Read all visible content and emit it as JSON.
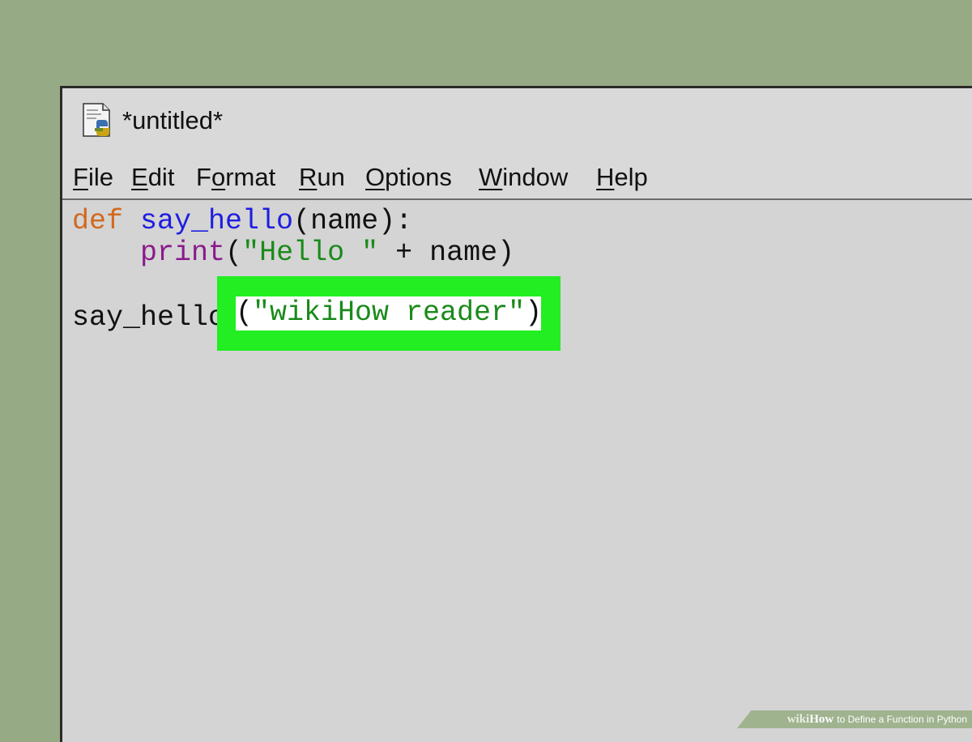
{
  "window": {
    "title": "*untitled*",
    "icon": "python-file-icon"
  },
  "menu": {
    "items": [
      {
        "first": "F",
        "rest": "ile"
      },
      {
        "first": "E",
        "rest": "dit"
      },
      {
        "pre": "F",
        "first": "o",
        "rest": "rmat"
      },
      {
        "first": "R",
        "rest": "un"
      },
      {
        "first": "O",
        "rest": "ptions"
      },
      {
        "first": "W",
        "rest": "indow"
      },
      {
        "first": "H",
        "rest": "elp"
      }
    ]
  },
  "code": {
    "line1": {
      "kw": "def",
      "space": " ",
      "name": "say_hello",
      "rest": "(name):"
    },
    "line2": {
      "indent": "    ",
      "builtin": "print",
      "open": "(",
      "string": "\"Hello \"",
      "rest": " + name)"
    },
    "line4": {
      "call": "say_hello",
      "open": "(",
      "string": "\"wikiHow reader\"",
      "close": ")"
    }
  },
  "watermark": {
    "wiki": "wiki",
    "how": "How",
    "text": "to Define a Function in Python"
  },
  "colors": {
    "background": "#96aa86",
    "keyword": "#d2691e",
    "function": "#1e1ee0",
    "builtin": "#8b1a8b",
    "string": "#1a8a1a",
    "highlight": "#22ee22"
  }
}
